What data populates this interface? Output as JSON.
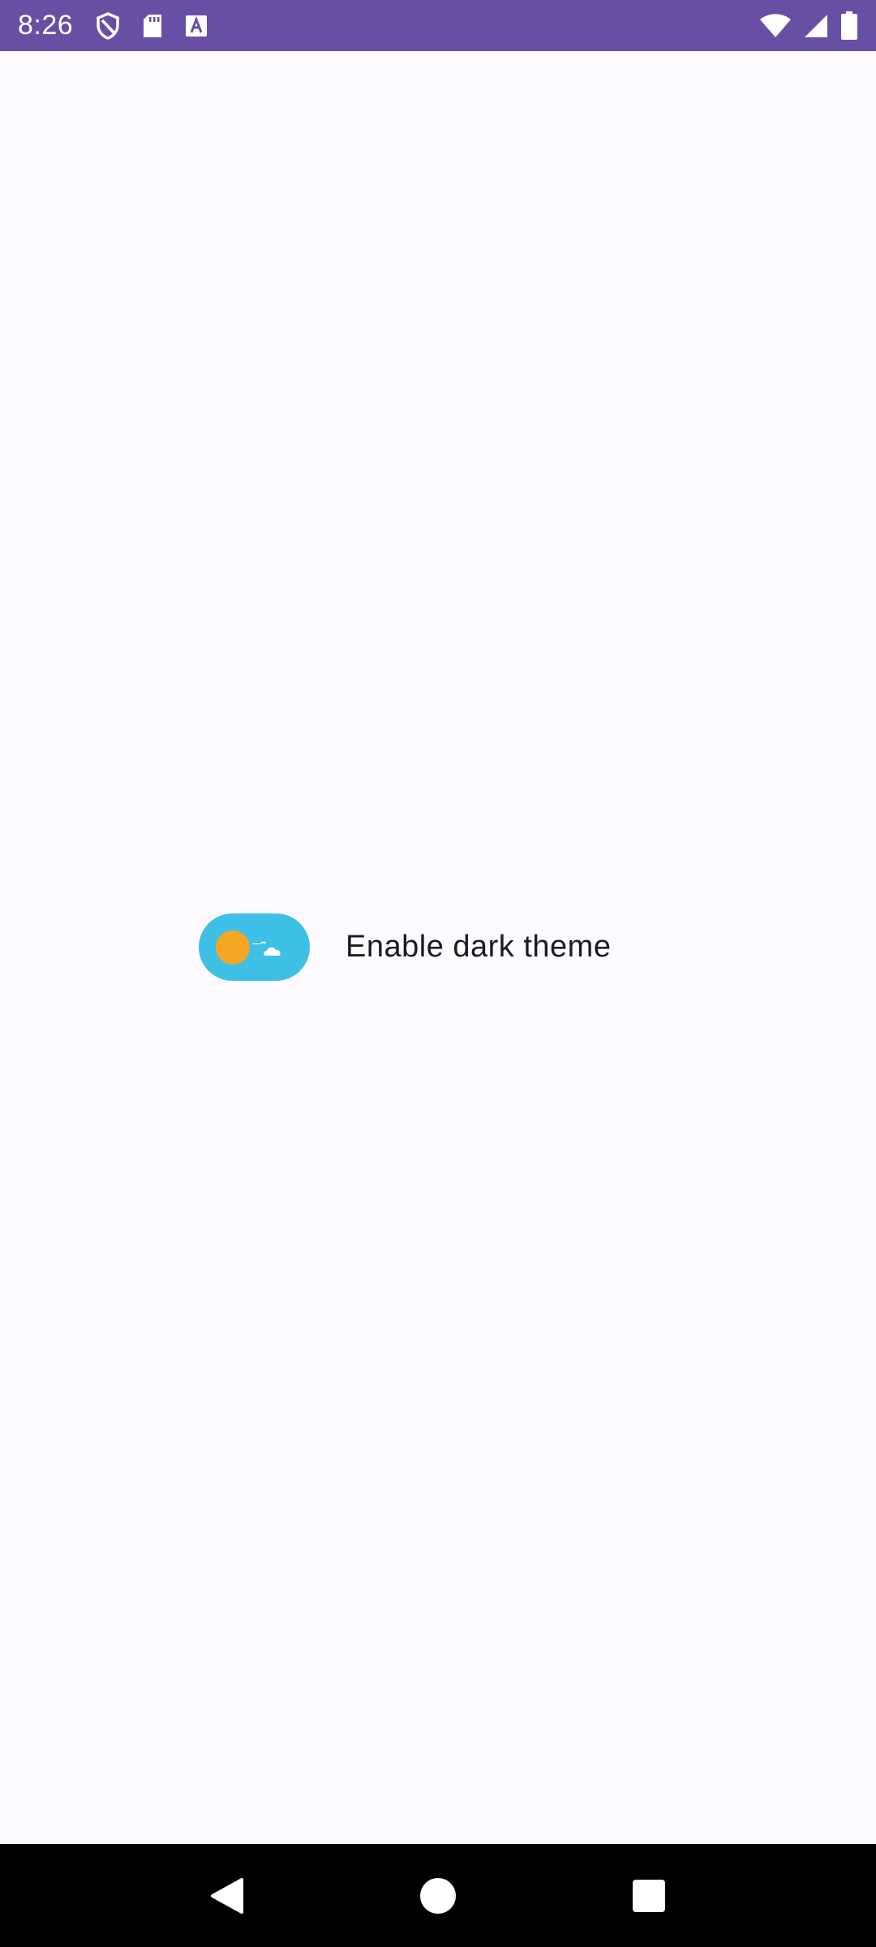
{
  "status_bar": {
    "time": "8:26",
    "background": "#6750A4",
    "left_icons": [
      "shield-icon",
      "sd-card-icon",
      "keyboard-a-icon"
    ],
    "right_icons": [
      "wifi-icon",
      "cellular-signal-icon",
      "battery-icon"
    ]
  },
  "main": {
    "background": "#FDFBFF",
    "theme_toggle": {
      "label": "Enable dark theme",
      "checked": false,
      "track_color": "#3EC0E6",
      "knob_color": "#F5A623",
      "icon": "sun-with-clouds-icon"
    }
  },
  "nav_bar": {
    "buttons": [
      "back-icon",
      "home-icon",
      "recents-icon"
    ]
  }
}
